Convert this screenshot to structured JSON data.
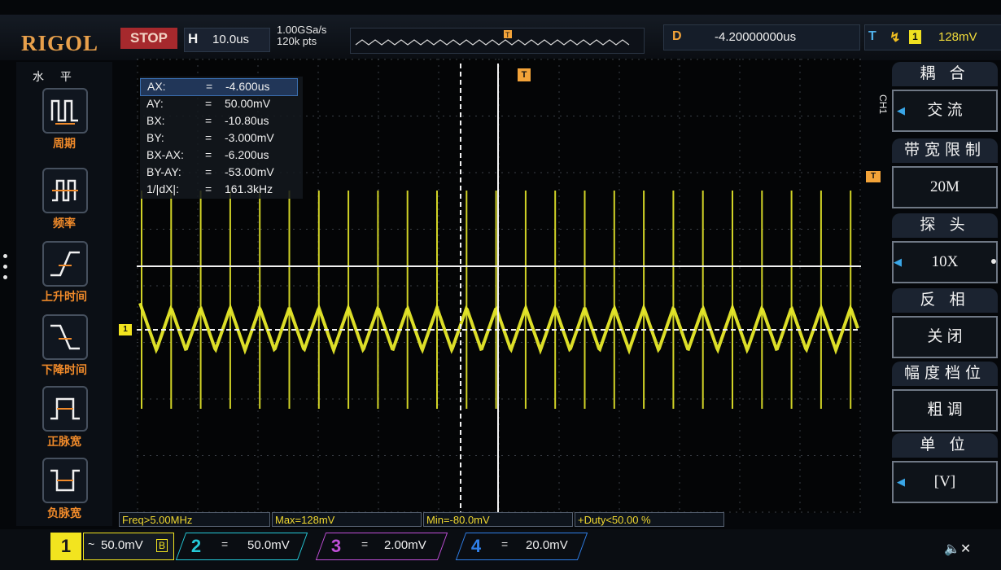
{
  "brand": "RIGOL",
  "run_state": "STOP",
  "horizontal": {
    "label": "H",
    "timebase": "10.0us"
  },
  "sampling": {
    "rate": "1.00GSa/s",
    "points": "120k pts"
  },
  "delay": {
    "label": "D",
    "value": "-4.20000000us"
  },
  "trigger": {
    "label": "T",
    "edge_icon": "rising-edge",
    "source": "1",
    "level": "128mV"
  },
  "trigger_marker": "T",
  "left_menu": {
    "title": "水 平",
    "items": [
      {
        "label": "周期",
        "icon": "period-icon"
      },
      {
        "label": "频率",
        "icon": "frequency-icon"
      },
      {
        "label": "上升时间",
        "icon": "rise-time-icon"
      },
      {
        "label": "下降时间",
        "icon": "fall-time-icon"
      },
      {
        "label": "正脉宽",
        "icon": "positive-width-icon"
      },
      {
        "label": "负脉宽",
        "icon": "negative-width-icon"
      }
    ]
  },
  "cursors": [
    {
      "key": "AX:",
      "eq": "=",
      "value": "-4.600us"
    },
    {
      "key": "AY:",
      "eq": "=",
      "value": "50.00mV"
    },
    {
      "key": "BX:",
      "eq": "=",
      "value": "-10.80us"
    },
    {
      "key": "BY:",
      "eq": "=",
      "value": "-3.000mV"
    },
    {
      "key": "BX-AX:",
      "eq": "=",
      "value": "-6.200us"
    },
    {
      "key": "BY-AY:",
      "eq": "=",
      "value": "-53.00mV"
    },
    {
      "key": "1/|dX|:",
      "eq": "=",
      "value": "161.3kHz"
    }
  ],
  "right_menu": {
    "side_label": "CH1",
    "sections": [
      {
        "title": "耦 合",
        "value": "交 流"
      },
      {
        "title": "带宽限制",
        "value": "20M"
      },
      {
        "title": "探 头",
        "value": "10X"
      },
      {
        "title": "反 相",
        "value": "关 闭"
      },
      {
        "title": "幅度档位",
        "value": "粗 调"
      },
      {
        "title": "单 位",
        "value": "[V]"
      }
    ]
  },
  "measurements": [
    "Freq>5.00MHz",
    "Max=128mV",
    "Min=-80.0mV",
    "+Duty<50.00 %"
  ],
  "channels": [
    {
      "num": "1",
      "coupling": "~",
      "scale": "50.0mV",
      "suffix": "B",
      "color": "#f2e41f"
    },
    {
      "num": "2",
      "coupling": "=",
      "scale": "50.0mV",
      "color": "#25c9d8"
    },
    {
      "num": "3",
      "coupling": "=",
      "scale": "2.00mV",
      "color": "#c04fd8"
    },
    {
      "num": "4",
      "coupling": "=",
      "scale": "20.0mV",
      "color": "#2f7fe8"
    }
  ],
  "colors": {
    "trace": "#e8ea2a",
    "accent": "#f08a2a",
    "trigger": "#f3a339"
  }
}
